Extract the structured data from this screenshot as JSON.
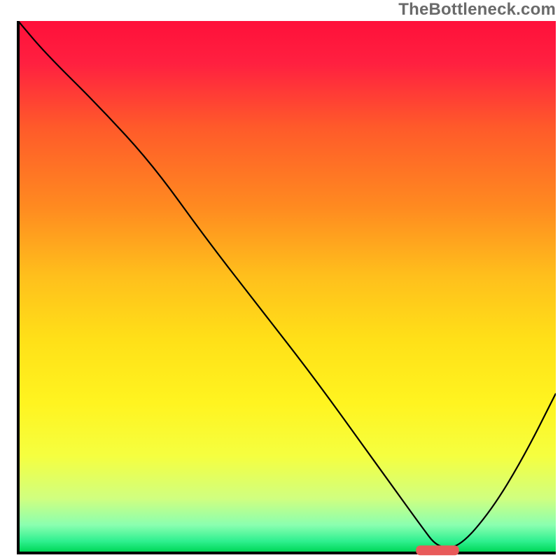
{
  "watermark": "TheBottleneck.com",
  "chart_data": {
    "type": "line",
    "title": "",
    "xlabel": "",
    "ylabel": "",
    "xlim": [
      0,
      100
    ],
    "ylim": [
      0,
      100
    ],
    "grid": false,
    "legend": false,
    "x": [
      0,
      5,
      15,
      25,
      35,
      45,
      55,
      65,
      70,
      75,
      78,
      82,
      88,
      94,
      100
    ],
    "y": [
      100,
      94,
      84,
      73,
      59,
      46,
      33,
      19,
      12,
      5,
      1,
      1,
      8,
      18,
      30
    ],
    "marker": {
      "x_range": [
        74,
        82
      ],
      "y": 0.5,
      "color": "#e85a5a"
    },
    "gradient_stops": [
      {
        "offset": 0.0,
        "color": "#ff103a"
      },
      {
        "offset": 0.2,
        "color": "#ff5a2a"
      },
      {
        "offset": 0.4,
        "color": "#ffa21e"
      },
      {
        "offset": 0.55,
        "color": "#ffd41a"
      },
      {
        "offset": 0.7,
        "color": "#fff11a"
      },
      {
        "offset": 0.82,
        "color": "#f7ff3a"
      },
      {
        "offset": 0.9,
        "color": "#d2ff7a"
      },
      {
        "offset": 0.95,
        "color": "#8affb0"
      },
      {
        "offset": 1.0,
        "color": "#00e060"
      }
    ]
  }
}
